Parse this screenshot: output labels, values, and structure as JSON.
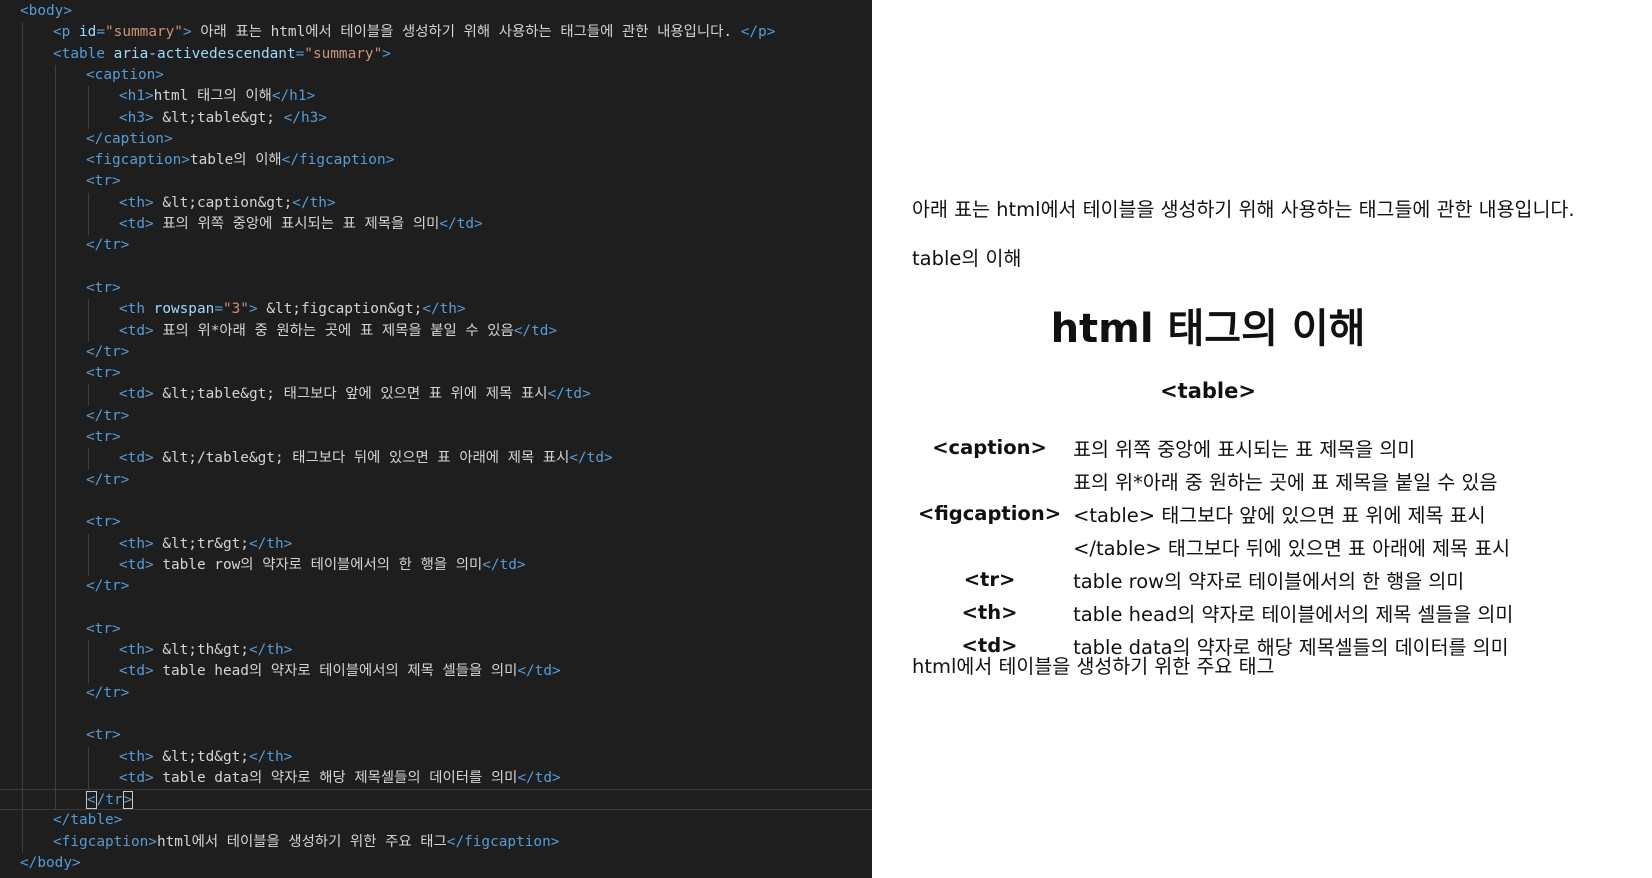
{
  "editor": {
    "lines": [
      {
        "html": "<span class=\"tag\">&lt;body&gt;</span>",
        "indent": 0
      },
      {
        "html": "<span class=\"tag\">&lt;p </span><span class=\"attr\">id</span><span class=\"tag\">=</span><span class=\"str\">\"summary\"</span><span class=\"tag\">&gt;</span> 아래 표는 html에서 테이블을 생성하기 위해 사용하는 태그들에 관한 내용입니다. <span class=\"tag\">&lt;/p&gt;</span>",
        "indent": 1
      },
      {
        "html": "<span class=\"tag\">&lt;table </span><span class=\"attr\">aria-activedescendant</span><span class=\"tag\">=</span><span class=\"str\">\"summary\"</span><span class=\"tag\">&gt;</span>",
        "indent": 1
      },
      {
        "html": "<span class=\"tag\">&lt;caption&gt;</span>",
        "indent": 2
      },
      {
        "html": "<span class=\"tag\">&lt;h1&gt;</span>html 태그의 이해<span class=\"tag\">&lt;/h1&gt;</span>",
        "indent": 3
      },
      {
        "html": "<span class=\"tag\">&lt;h3&gt;</span> &amp;lt;table&amp;gt; <span class=\"tag\">&lt;/h3&gt;</span>",
        "indent": 3
      },
      {
        "html": "<span class=\"tag\">&lt;/caption&gt;</span>",
        "indent": 2
      },
      {
        "html": "<span class=\"tag\">&lt;figcaption&gt;</span>table의 이해<span class=\"tag\">&lt;/figcaption&gt;</span>",
        "indent": 2
      },
      {
        "html": "<span class=\"tag\">&lt;tr&gt;</span>",
        "indent": 2
      },
      {
        "html": "<span class=\"tag\">&lt;th&gt;</span> &amp;lt;caption&amp;gt;<span class=\"tag\">&lt;/th&gt;</span>",
        "indent": 3
      },
      {
        "html": "<span class=\"tag\">&lt;td&gt;</span> 표의 위쪽 중앙에 표시되는 표 제목을 의미<span class=\"tag\">&lt;/td&gt;</span>",
        "indent": 3
      },
      {
        "html": "<span class=\"tag\">&lt;/tr&gt;</span>",
        "indent": 2
      },
      {
        "html": "",
        "indent": 2
      },
      {
        "html": "<span class=\"tag\">&lt;tr&gt;</span>",
        "indent": 2
      },
      {
        "html": "<span class=\"tag\">&lt;th </span><span class=\"attr\">rowspan</span><span class=\"tag\">=</span><span class=\"str\">\"3\"</span><span class=\"tag\">&gt;</span> &amp;lt;figcaption&amp;gt;<span class=\"tag\">&lt;/th&gt;</span>",
        "indent": 3
      },
      {
        "html": "<span class=\"tag\">&lt;td&gt;</span> 표의 위*아래 중 원하는 곳에 표 제목을 붙일 수 있음<span class=\"tag\">&lt;/td&gt;</span>",
        "indent": 3
      },
      {
        "html": "<span class=\"tag\">&lt;/tr&gt;</span>",
        "indent": 2
      },
      {
        "html": "<span class=\"tag\">&lt;tr&gt;</span>",
        "indent": 2
      },
      {
        "html": "<span class=\"tag\">&lt;td&gt;</span> &amp;lt;table&amp;gt; 태그보다 앞에 있으면 표 위에 제목 표시<span class=\"tag\">&lt;/td&gt;</span>",
        "indent": 3
      },
      {
        "html": "<span class=\"tag\">&lt;/tr&gt;</span>",
        "indent": 2
      },
      {
        "html": "<span class=\"tag\">&lt;tr&gt;</span>",
        "indent": 2
      },
      {
        "html": "<span class=\"tag\">&lt;td&gt;</span> &amp;lt;/table&amp;gt; 태그보다 뒤에 있으면 표 아래에 제목 표시<span class=\"tag\">&lt;/td&gt;</span>",
        "indent": 3
      },
      {
        "html": "<span class=\"tag\">&lt;/tr&gt;</span>",
        "indent": 2
      },
      {
        "html": "",
        "indent": 2
      },
      {
        "html": "<span class=\"tag\">&lt;tr&gt;</span>",
        "indent": 2
      },
      {
        "html": "<span class=\"tag\">&lt;th&gt;</span> &amp;lt;tr&amp;gt;<span class=\"tag\">&lt;/th&gt;</span>",
        "indent": 3
      },
      {
        "html": "<span class=\"tag\">&lt;td&gt;</span> table row의 약자로 테이블에서의 한 행을 의미<span class=\"tag\">&lt;/td&gt;</span>",
        "indent": 3
      },
      {
        "html": "<span class=\"tag\">&lt;/tr&gt;</span>",
        "indent": 2
      },
      {
        "html": "",
        "indent": 2
      },
      {
        "html": "<span class=\"tag\">&lt;tr&gt;</span>",
        "indent": 2
      },
      {
        "html": "<span class=\"tag\">&lt;th&gt;</span> &amp;lt;th&amp;gt;<span class=\"tag\">&lt;/th&gt;</span>",
        "indent": 3
      },
      {
        "html": "<span class=\"tag\">&lt;td&gt;</span> table head의 약자로 테이블에서의 제목 셀들을 의미<span class=\"tag\">&lt;/td&gt;</span>",
        "indent": 3
      },
      {
        "html": "<span class=\"tag\">&lt;/tr&gt;</span>",
        "indent": 2
      },
      {
        "html": "",
        "indent": 2
      },
      {
        "html": "<span class=\"tag\">&lt;tr&gt;</span>",
        "indent": 2
      },
      {
        "html": "<span class=\"tag\">&lt;th&gt;</span> &amp;lt;td&amp;gt;<span class=\"tag\">&lt;/th&gt;</span>",
        "indent": 3
      },
      {
        "html": "<span class=\"tag\">&lt;td&gt;</span> table data의 약자로 해당 제목셀들의 데이터를 의미<span class=\"tag\">&lt;/td&gt;</span>",
        "indent": 3
      },
      {
        "html": "<span class=\"tag\"><span class=\"cursor-box\">&lt;</span>/tr<span class=\"cursor-box\">&gt;</span></span>",
        "indent": 2,
        "current": true
      },
      {
        "html": "<span class=\"tag\">&lt;/table&gt;</span>",
        "indent": 1
      },
      {
        "html": "<span class=\"tag\">&lt;figcaption&gt;</span>html에서 테이블을 생성하기 위한 주요 태그<span class=\"tag\">&lt;/figcaption&gt;</span>",
        "indent": 1
      },
      {
        "html": "<span class=\"tag\">&lt;/body&gt;</span>",
        "indent": 0
      }
    ]
  },
  "preview": {
    "summary": "아래 표는 html에서 테이블을 생성하기 위해 사용하는 태그들에 관한 내용입니다.",
    "figcaption_top": "table의 이해",
    "h1": "html 태그의 이해",
    "h3": "<table>",
    "rows": {
      "caption_th": "<caption>",
      "caption_td": "표의 위쪽 중앙에 표시되는 표 제목을 의미",
      "figcaption_th": "<figcaption>",
      "figcaption_td1": "표의 위*아래 중 원하는 곳에 표 제목을 붙일 수 있음",
      "figcaption_td2": "<table> 태그보다 앞에 있으면 표 위에 제목 표시",
      "figcaption_td3": "</table> 태그보다 뒤에 있으면 표 아래에 제목 표시",
      "tr_th": "<tr>",
      "tr_td": "table row의 약자로 테이블에서의 한 행을 의미",
      "th_th": "<th>",
      "th_td": "table head의 약자로 테이블에서의 제목 셀들을 의미",
      "td_th": "<td>",
      "td_td": "table data의 약자로 해당 제목셀들의 데이터를 의미"
    },
    "figcaption_bottom": "html에서 테이블을 생성하기 위한 주요 태그"
  }
}
